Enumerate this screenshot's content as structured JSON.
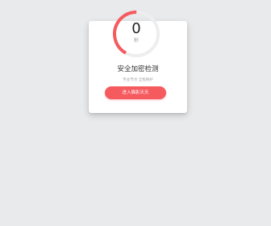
{
  "timer": {
    "value": "0",
    "unit": "秒",
    "progress": 0.42
  },
  "card": {
    "title": "安全加密检测",
    "subtitle": "专业节点 全程保护"
  },
  "enter_button": {
    "label": "进入猫影天天"
  },
  "colors": {
    "background": "#e8eaeb",
    "accent": "#f55a5f",
    "ring_track": "#eeeeee"
  }
}
